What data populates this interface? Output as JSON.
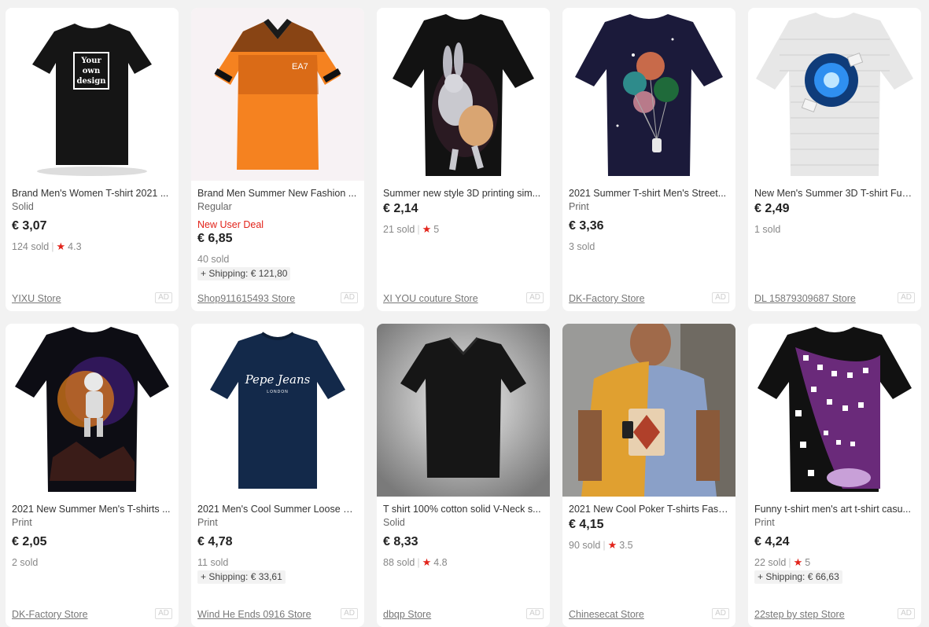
{
  "products": [
    {
      "title": "Brand Men's Women T-shirt 2021 ...",
      "variant": "Solid",
      "deal": "",
      "price": "€ 3,07",
      "sold": "124 sold",
      "rating": "4.3",
      "shipping": "",
      "store": "YIXU Store",
      "ad": "AD",
      "image_icon": "black-tshirt-your-own-design",
      "print_lines": [
        "Your",
        "own",
        "design"
      ],
      "print_text": ""
    },
    {
      "title": "Brand Men Summer New Fashion ...",
      "variant": "Regular",
      "deal": "New User Deal",
      "price": "€ 6,85",
      "sold": "40 sold",
      "rating": "",
      "shipping": "+ Shipping: € 121,80",
      "store": "Shop911615493 Store",
      "ad": "AD",
      "image_icon": "orange-polo-shirt",
      "print_lines": [],
      "print_text": "EA7"
    },
    {
      "title": "Summer new style 3D printing sim...",
      "variant": "",
      "deal": "",
      "price": "€ 2,14",
      "sold": "21 sold",
      "rating": "5",
      "shipping": "",
      "store": "XI YOU couture Store",
      "ad": "AD",
      "image_icon": "black-tshirt-cartoon-rabbit",
      "print_lines": [],
      "print_text": ""
    },
    {
      "title": "2021 Summer T-shirt Men's Street...",
      "variant": "Print",
      "deal": "",
      "price": "€ 3,36",
      "sold": "3 sold",
      "rating": "",
      "shipping": "",
      "store": "DK-Factory Store",
      "ad": "AD",
      "image_icon": "galaxy-tshirt-planet-balloons",
      "print_lines": [],
      "print_text": ""
    },
    {
      "title": "New Men's Summer 3D T-shirt Fun...",
      "variant": "",
      "deal": "",
      "price": "€ 2,49",
      "sold": "1 sold",
      "rating": "",
      "shipping": "",
      "store": "DL 15879309687 Store",
      "ad": "AD",
      "image_icon": "brick-wall-3d-tshirt",
      "print_lines": [],
      "print_text": ""
    },
    {
      "title": "2021 New Summer Men's T-shirts ...",
      "variant": "Print",
      "deal": "",
      "price": "€ 2,05",
      "sold": "2 sold",
      "rating": "",
      "shipping": "",
      "store": "DK-Factory Store",
      "ad": "AD",
      "image_icon": "astronaut-galaxy-tshirt",
      "print_lines": [],
      "print_text": ""
    },
    {
      "title": "2021 Men's Cool Summer Loose M...",
      "variant": "Print",
      "deal": "",
      "price": "€ 4,78",
      "sold": "11 sold",
      "rating": "",
      "shipping": "+ Shipping: € 33,61",
      "store": "Wind He Ends 0916 Store",
      "ad": "AD",
      "image_icon": "navy-pepe-jeans-tshirt",
      "print_lines": [],
      "print_text": "Pepe Jeans",
      "print_subtext": "LONDON"
    },
    {
      "title": "T shirt 100% cotton solid V-Neck s...",
      "variant": "Solid",
      "deal": "",
      "price": "€ 8,33",
      "sold": "88 sold",
      "rating": "4.8",
      "shipping": "",
      "store": "dbqp Store",
      "ad": "AD",
      "image_icon": "black-vneck-tshirt",
      "print_lines": [],
      "print_text": ""
    },
    {
      "title": "2021 New Cool Poker T-shirts Fash...",
      "variant": "",
      "deal": "",
      "price": "€ 4,15",
      "sold": "90 sold",
      "rating": "3.5",
      "shipping": "",
      "store": "Chinesecat Store",
      "ad": "AD",
      "image_icon": "poker-card-tshirt-model",
      "print_lines": [],
      "print_text": ""
    },
    {
      "title": "Funny t-shirt men's art t-shirt casu...",
      "variant": "Print",
      "deal": "",
      "price": "€ 4,24",
      "sold": "22 sold",
      "rating": "5",
      "shipping": "+ Shipping: € 66,63",
      "store": "22step by step Store",
      "ad": "AD",
      "image_icon": "purple-tunnel-3d-tshirt",
      "print_lines": [],
      "print_text": ""
    }
  ],
  "colors": {
    "accent_red": "#e2231a",
    "page_bg": "#f2f2f2"
  }
}
